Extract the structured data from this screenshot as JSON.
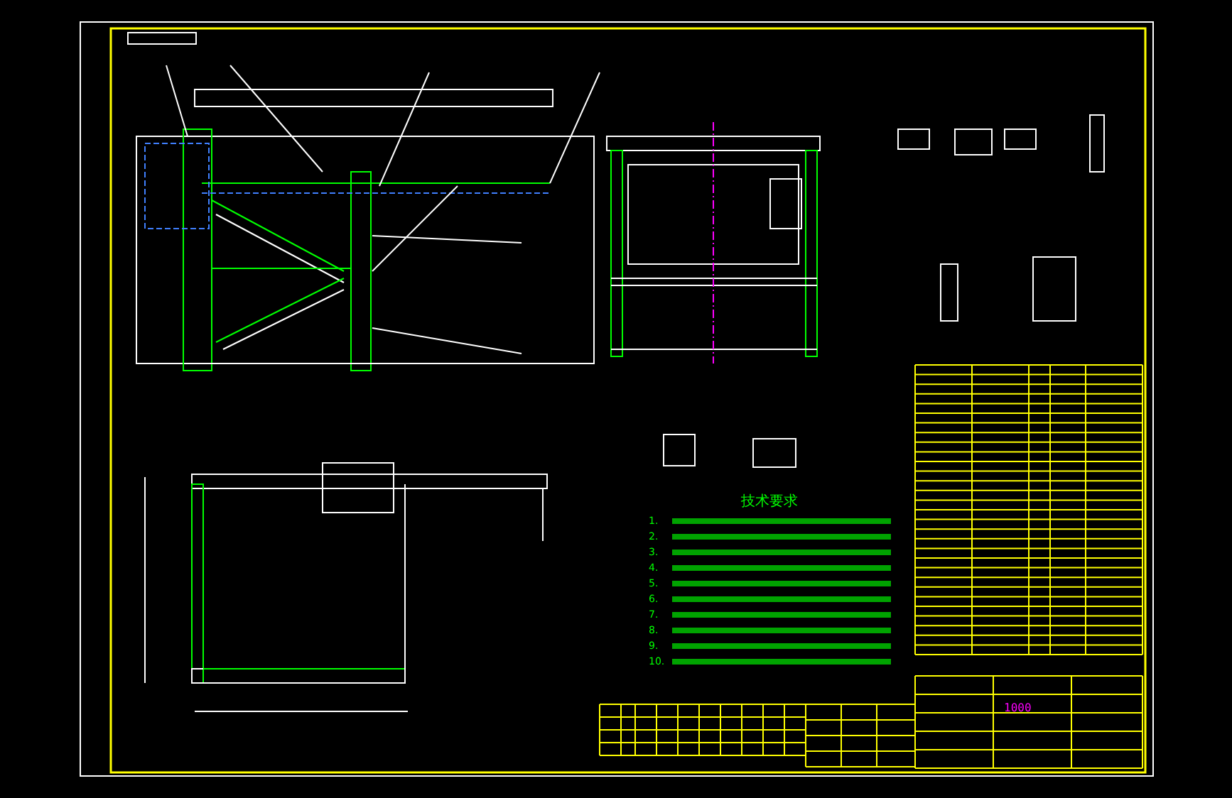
{
  "notes": {
    "heading": "技术要求",
    "items": [
      "1.",
      "2.",
      "3.",
      "4.",
      "5.",
      "6.",
      "7.",
      "8.",
      "9.",
      "10."
    ]
  },
  "title_block": {
    "code": "1000"
  }
}
